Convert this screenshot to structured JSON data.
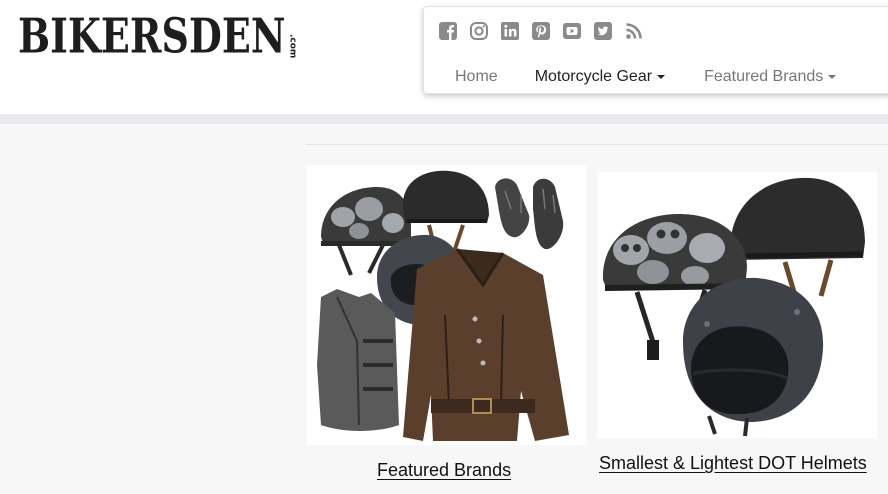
{
  "header": {
    "logo_main": "BIKERSDEN",
    "logo_tld": ".com"
  },
  "social_icons": [
    "facebook-icon",
    "instagram-icon",
    "linkedin-icon",
    "pinterest-icon",
    "youtube-icon",
    "twitter-icon",
    "rss-icon"
  ],
  "nav": {
    "items": [
      {
        "label": "Home",
        "has_dropdown": false,
        "active": false
      },
      {
        "label": "Motorcycle Gear",
        "has_dropdown": true,
        "active": true
      },
      {
        "label": "Featured Brands",
        "has_dropdown": true,
        "active": false
      }
    ]
  },
  "cards": [
    {
      "caption": "Featured Brands",
      "image": "motorcycle-gear-collage"
    },
    {
      "caption": "Smallest & Lightest DOT Helmets",
      "image": "dot-helmets"
    }
  ],
  "colors": {
    "social_icon": "#8a8a8a",
    "nav_text": "#777777",
    "nav_active": "#222222",
    "band": "#e9eaee",
    "logo": "#1e1e1e"
  }
}
